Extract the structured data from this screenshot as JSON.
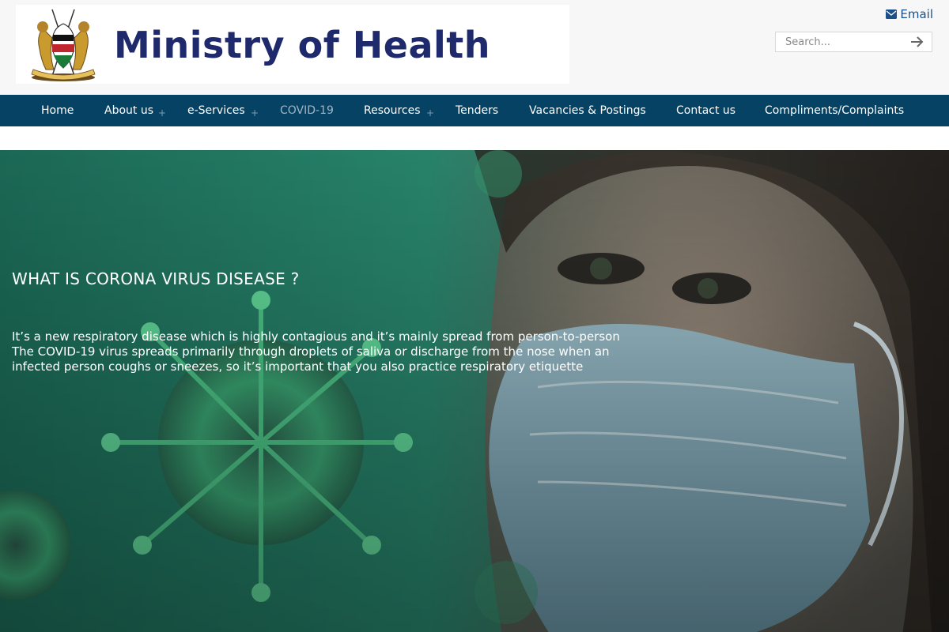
{
  "header": {
    "site_title": "Ministry of Health",
    "email_label": "Email",
    "search_placeholder": "Search..."
  },
  "nav": {
    "items": [
      {
        "label": "Home"
      },
      {
        "label": "About us",
        "plus": "+"
      },
      {
        "label": "e-Services",
        "plus": "+"
      },
      {
        "label": "COVID-19",
        "active": true
      },
      {
        "label": "Resources",
        "plus": "+"
      },
      {
        "label": "Tenders"
      },
      {
        "label": "Vacancies & Postings"
      },
      {
        "label": "Contact us"
      },
      {
        "label": "Compliments/Complaints"
      }
    ]
  },
  "hero": {
    "title": "WHAT IS CORONA VIRUS DISEASE ?",
    "body": "It’s a new respiratory disease which is highly contagious and it’s mainly spread from person-to-person The COVID-19 virus spreads primarily through droplets of saliva or discharge from the nose when an infected person coughs or sneezes, so it’s important that you also practice respiratory etiquette"
  },
  "colors": {
    "nav_bg": "#064263",
    "title_color": "#1f2a6d",
    "hero_tint": "#1b8a6a"
  },
  "icons": [
    "kenya-coat-of-arms-logo",
    "envelope-icon",
    "arrow-right-icon"
  ]
}
